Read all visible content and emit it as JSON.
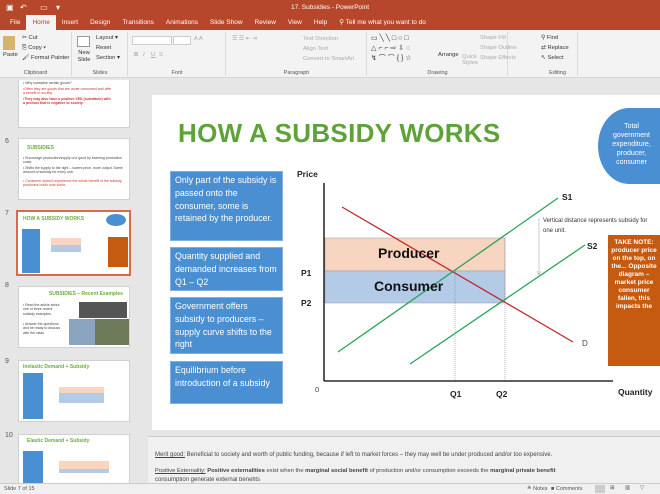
{
  "window": {
    "title": "17. Subsidies - PowerPoint"
  },
  "tabs": [
    "File",
    "Home",
    "Insert",
    "Design",
    "Transitions",
    "Animations",
    "Slide Show",
    "Review",
    "View",
    "Help"
  ],
  "tell_me": "Tell me what you want to do",
  "ribbon": {
    "clipboard": {
      "paste": "Paste",
      "cut": "Cut",
      "copy": "Copy",
      "format_painter": "Format Painter",
      "label": "Clipboard"
    },
    "slides": {
      "new_slide": "New Slide",
      "layout": "Layout",
      "reset": "Reset",
      "section": "Section",
      "label": "Slides"
    },
    "font": {
      "bold": "B",
      "italic": "I",
      "underline": "U",
      "strike": "S",
      "label": "Font"
    },
    "paragraph": {
      "text_direction": "Text Direction",
      "align_text": "Align Text",
      "smartart": "Convert to SmartArt",
      "label": "Paragraph"
    },
    "drawing": {
      "arrange": "Arrange",
      "quick_styles": "Quick Styles",
      "shape_fill": "Shape Fill",
      "shape_outline": "Shape Outline",
      "shape_effects": "Shape Effects",
      "label": "Drawing"
    },
    "editing": {
      "find": "Find",
      "replace": "Replace",
      "select": "Select",
      "label": "Editing"
    }
  },
  "thumbnails": [
    {
      "num": "",
      "lines": [
        "• Why subsidise certain goods?",
        "•Often they are goods that are under consumed and offer a benefit to society.",
        "•They may also have a positive XED (substitute) with a product that is negative to society."
      ]
    },
    {
      "num": "6",
      "title": "SUBSIDIES",
      "lines": [
        "• Encourage production/supply of a good by lowering production costs.",
        "• Shifts the supply to the right – lowers price, more output. Same amount of subsidy for every unit.",
        "• Consumer doesn't experience the whole benefit of the subsidy, producers holds onto some."
      ]
    },
    {
      "num": "7",
      "title": "HOW A SUBSIDY WORKS"
    },
    {
      "num": "8",
      "title": "SUBSIDIES – Recent Examples",
      "lines": [
        "• Read the article about one of three recent subsidy examples",
        "• Answer the questions and be ready to discuss with the class"
      ]
    },
    {
      "num": "9",
      "title": "Inelastic Demand + Subsidy"
    },
    {
      "num": "10",
      "title": "Elastic Demand + Subsidy"
    }
  ],
  "slide": {
    "title": "HOW A SUBSIDY WORKS",
    "ellipse_text": "Total government expenditure, producer, consumer",
    "boxes": [
      "Only part of the subsidy is passed onto the consumer, some is retained by the producer.",
      "Quantity supplied and demanded increases from Q1 – Q2",
      "Government offers subsidy to producers – supply curve shifts to the right",
      "Equilibrium before introduction of a subsidy"
    ],
    "orange_box": "TAKE NOTE: producer price on the top, on the... Opposite diagram – market price consumer fallen, this impacts the",
    "chart": {
      "ylabel": "Price",
      "xlabel": "Quantity",
      "origin": "0",
      "p1": "P1",
      "p2": "P2",
      "q1": "Q1",
      "q2": "Q2",
      "s1": "S1",
      "s2": "S2",
      "d": "D",
      "producer": "Producer",
      "consumer": "Consumer",
      "annotation": "Vertical distance represents subsidy for one unit."
    }
  },
  "notes": {
    "line1_term": "Merit good:",
    "line1": " Beneficial to society and worth of public funding, because if left to market forces – they may well be    under produced and/or too expensive.",
    "line2_term": "Positive Externality:",
    "line2_a": " Positive externalities",
    "line2_b": " exist when the ",
    "line2_c": "marginal social benefit",
    "line2_d": " of production and/or consumption exceeds the ",
    "line2_e": "marginal private benefit",
    "line3": "consumption generate external benefits"
  },
  "status": {
    "slide": "Slide 7 of 15",
    "notes": "Notes",
    "comments": "Comments"
  },
  "colors": {
    "accent": "#b7472a",
    "box_blue": "#4a8fd2",
    "orange": "#c55a11",
    "green": "#6aad3d"
  }
}
